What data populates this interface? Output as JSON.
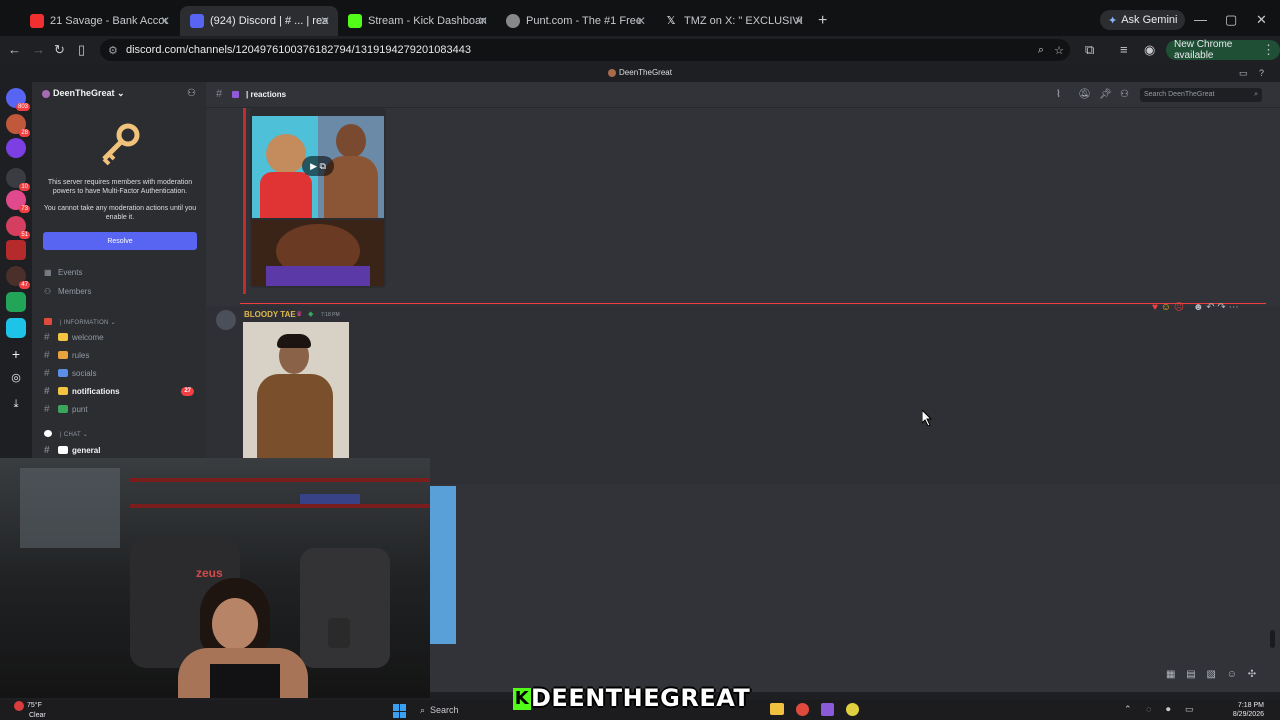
{
  "browser": {
    "tabs": [
      {
        "title": "21 Savage - Bank Account (Offi",
        "favicon": "#f03030"
      },
      {
        "title": "(924) Discord | # ... | reactions",
        "favicon": "#5865f2",
        "active": true
      },
      {
        "title": "Stream - Kick Dashboard",
        "favicon": "#53fc18"
      },
      {
        "title": "Punt.com - The #1 Free to Play",
        "favicon": "#888888"
      },
      {
        "title": "TMZ on X: \" EXCLUSIVE: Dez",
        "favicon": "#ffffff"
      }
    ],
    "ask_gemini": "Ask Gemini",
    "url": "discord.com/channels/1204976100376182794/1319194279201083443",
    "new_chrome": "New Chrome available"
  },
  "discord": {
    "window_title": "DeenTheGreat",
    "server_name": "DeenTheGreat",
    "mfa_text": "This server requires members with moderation powers to have Multi-Factor Authentication.",
    "mfa_text2": "You cannot take any moderation actions until you enable it.",
    "resolve_label": "Resolve",
    "events_label": "Events",
    "members_label": "Members",
    "category_info": "| INFORMATION",
    "channels": [
      {
        "name": "welcome",
        "emoji_color": "#f5c542"
      },
      {
        "name": "rules",
        "emoji_color": "#e8a33c"
      },
      {
        "name": "socials",
        "emoji_color": "#5a8ee8"
      },
      {
        "name": "notifications",
        "emoji_color": "#f5c542",
        "bold": true,
        "count": "27"
      },
      {
        "name": "punt",
        "emoji_color": "#3ba55c"
      }
    ],
    "category_chat": "| CHAT",
    "chat_channels": [
      {
        "name": "general",
        "bold": true
      }
    ],
    "rail_badges": [
      "803",
      "28",
      "10",
      "73",
      "51",
      "47"
    ],
    "channel_title": "| reactions",
    "search_placeholder": "Search DeenTheGreat",
    "message_author": "BLOODY TAE",
    "message_time": "7:18 PM"
  },
  "taskbar": {
    "weather_temp": "75°F",
    "weather_desc": "Clear",
    "search_label": "Search",
    "time": "7:18 PM",
    "date": "8/29/2026"
  },
  "overlay_text": "DEENTHEGREAT"
}
